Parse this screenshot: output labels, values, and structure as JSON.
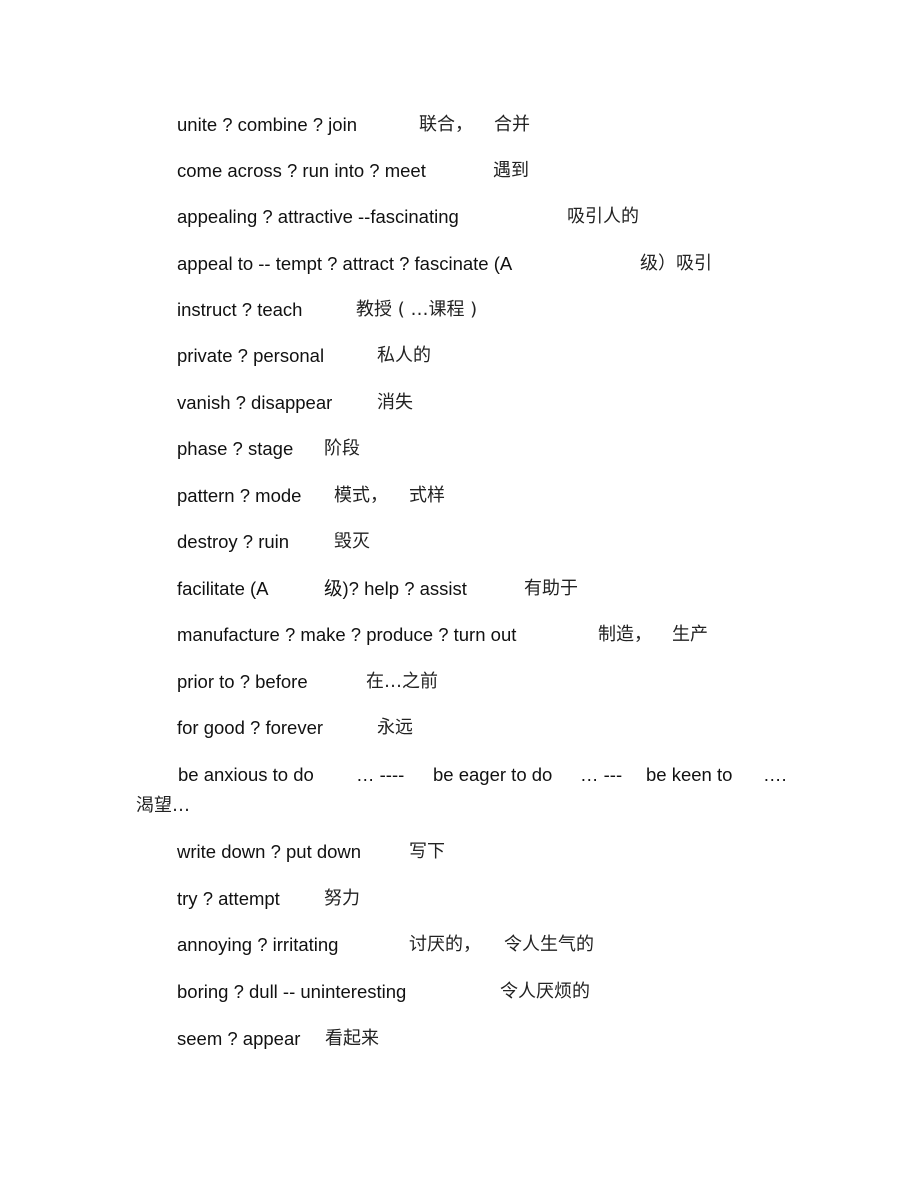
{
  "document": {
    "lines": [
      {
        "en": "unite ? combine ? join",
        "zh": "联合，",
        "zh2": "合并"
      },
      {
        "en": "come across ? run into ? meet",
        "zh": "遇到"
      },
      {
        "en": "appealing ? attractive --fascinating",
        "zh": "吸引人的"
      },
      {
        "en": "appeal to -- tempt ? attract ? fascinate (A",
        "zh": "级）吸引"
      },
      {
        "en": "instruct ? teach",
        "zh": "教授 ( …课程 )"
      },
      {
        "en": "private ? personal",
        "zh": "私人的"
      },
      {
        "en": "vanish ? disappear",
        "zh": "消失"
      },
      {
        "en": "phase ? stage",
        "zh": "阶段"
      },
      {
        "en": "pattern ? mode",
        "zh": "模式，",
        "zh2": "式样"
      },
      {
        "en": "destroy ? ruin",
        "zh": "毁灭"
      },
      {
        "en": "facilitate (A",
        "zh": "级)? help ? assist",
        "zh2": "有助于"
      },
      {
        "en": "manufacture ? make ? produce ? turn out",
        "zh": "制造，",
        "zh2": "生产"
      },
      {
        "en": "prior to ? before",
        "zh": "在…之前"
      },
      {
        "en": "for good ? forever",
        "zh": "永远"
      },
      {
        "en": "be anxious to do",
        "zh": "… ----",
        "en2": "be eager to do",
        "zh2": "… ---",
        "en3": "be keen to",
        "zh3": "….",
        "wrap": "渴望…"
      },
      {
        "en": "write down ? put down",
        "zh": "写下"
      },
      {
        "en": "try ? attempt",
        "zh": "努力"
      },
      {
        "en": "annoying ? irritating",
        "zh": "讨厌的，",
        "zh2": "令人生气的"
      },
      {
        "en": "boring ? dull -- uninteresting",
        "zh": "令人厌烦的"
      },
      {
        "en": "seem ? appear",
        "zh": "看起来"
      }
    ]
  }
}
